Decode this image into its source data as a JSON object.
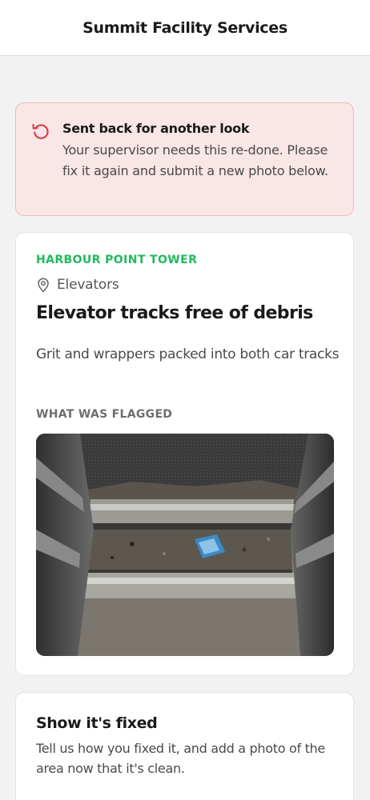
{
  "header": {
    "title": "Summit Facility Services"
  },
  "alert": {
    "icon": "undo-arrow-icon",
    "title": "Sent back for another look",
    "body": "Your supervisor needs this re-done. Please fix it again and submit a new photo below.",
    "border_color": "#efb9bd",
    "background_color": "#f9e6e7",
    "icon_color": "#d93c45"
  },
  "task": {
    "site": "HARBOUR POINT TOWER",
    "site_color": "#1fba5a",
    "location_icon": "location-pin-icon",
    "location": "Elevators",
    "title": "Elevator tracks free of debris",
    "description": "Grit and wrappers packed into both car tracks",
    "flag_label": "WHAT WAS FLAGGED",
    "photo": "flagged-photo-elevator-tracks"
  },
  "fix": {
    "title": "Show it's fixed",
    "description": "Tell us how you fixed it, and add a photo of the area now that it's clean."
  }
}
